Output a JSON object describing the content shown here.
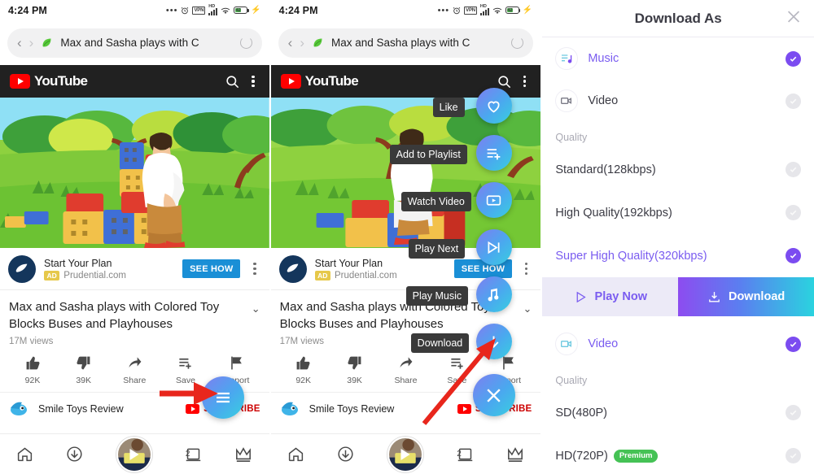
{
  "status_bar": {
    "time": "4:24 PM",
    "battery_text": "42",
    "icons": [
      "more-dots-icon",
      "alarm-icon",
      "vpn-icon",
      "hd-signal-icon",
      "wifi-icon",
      "battery-icon",
      "charging-bolt-icon"
    ]
  },
  "browser": {
    "back_label": "‹",
    "forward_label": "›",
    "site_title": "Max and Sasha plays with C",
    "reload_label": "reload"
  },
  "youtube_header": {
    "brand": "YouTube",
    "search_label": "search",
    "menu_label": "more options"
  },
  "ad": {
    "title": "Start Your Plan",
    "badge": "AD",
    "domain": "Prudential.com",
    "cta": "SEE HOW"
  },
  "video": {
    "title": "Max and Sasha plays with Colored Toy Blocks Buses and Playhouses",
    "views": "17M views",
    "actions": [
      {
        "label": "92K",
        "icon": "thumbs-up-icon"
      },
      {
        "label": "39K",
        "icon": "thumbs-down-icon"
      },
      {
        "label": "Share",
        "icon": "share-icon"
      },
      {
        "label": "Save",
        "icon": "save-playlist-icon"
      },
      {
        "label": "Report",
        "icon": "flag-icon"
      }
    ],
    "channel": "Smile Toys Review",
    "subscribe": "SUBSCRIBE"
  },
  "bottom_nav": [
    {
      "name": "home",
      "icon": "home-icon"
    },
    {
      "name": "downloads",
      "icon": "download-circle-icon"
    },
    {
      "name": "player",
      "icon": "player-thumbnail"
    },
    {
      "name": "tabs",
      "icon": "tabs-icon",
      "badge": "2"
    },
    {
      "name": "premium",
      "icon": "crown-icon"
    }
  ],
  "fab_menu": {
    "closed_icon": "hamburger-icon",
    "items": [
      {
        "label": "Like",
        "icon": "heart-icon"
      },
      {
        "label": "Add to Playlist",
        "icon": "playlist-add-icon"
      },
      {
        "label": "Watch Video",
        "icon": "watch-video-icon"
      },
      {
        "label": "Play Next",
        "icon": "play-next-icon"
      },
      {
        "label": "Play Music",
        "icon": "music-note-icon"
      },
      {
        "label": "Download",
        "icon": "download-arrow-icon"
      }
    ],
    "close_label": "close-icon"
  },
  "download_dialog": {
    "title": "Download As",
    "close_label": "close-icon",
    "music": {
      "label": "Music",
      "icon": "music-list-icon",
      "selected": true,
      "quality_label": "Quality",
      "options": [
        {
          "label": "Standard(128kbps)",
          "selected": false
        },
        {
          "label": "High Quality(192kbps)",
          "selected": false
        },
        {
          "label": "Super High Quality(320kbps)",
          "selected": true
        }
      ]
    },
    "buttons": {
      "play_now": "Play Now",
      "download": "Download",
      "play_icon": "play-triangle-icon",
      "download_icon": "download-tray-icon"
    },
    "video": {
      "label": "Video",
      "icon": "video-camera-icon",
      "selected": true,
      "quality_label": "Quality",
      "options": [
        {
          "label": "SD(480P)",
          "selected": false,
          "badge": ""
        },
        {
          "label": "HD(720P)",
          "selected": false,
          "badge": "Premium"
        }
      ]
    },
    "video_row_icon": "video-camera-icon",
    "video_row_label": "Video",
    "video_row_selected": true
  },
  "colors": {
    "accent_purple": "#7b4cf0",
    "yt_red": "#ff0000",
    "fab_blue": "#4aa8ef",
    "premium_green": "#45c255",
    "arrow_red": "#e8261c"
  }
}
